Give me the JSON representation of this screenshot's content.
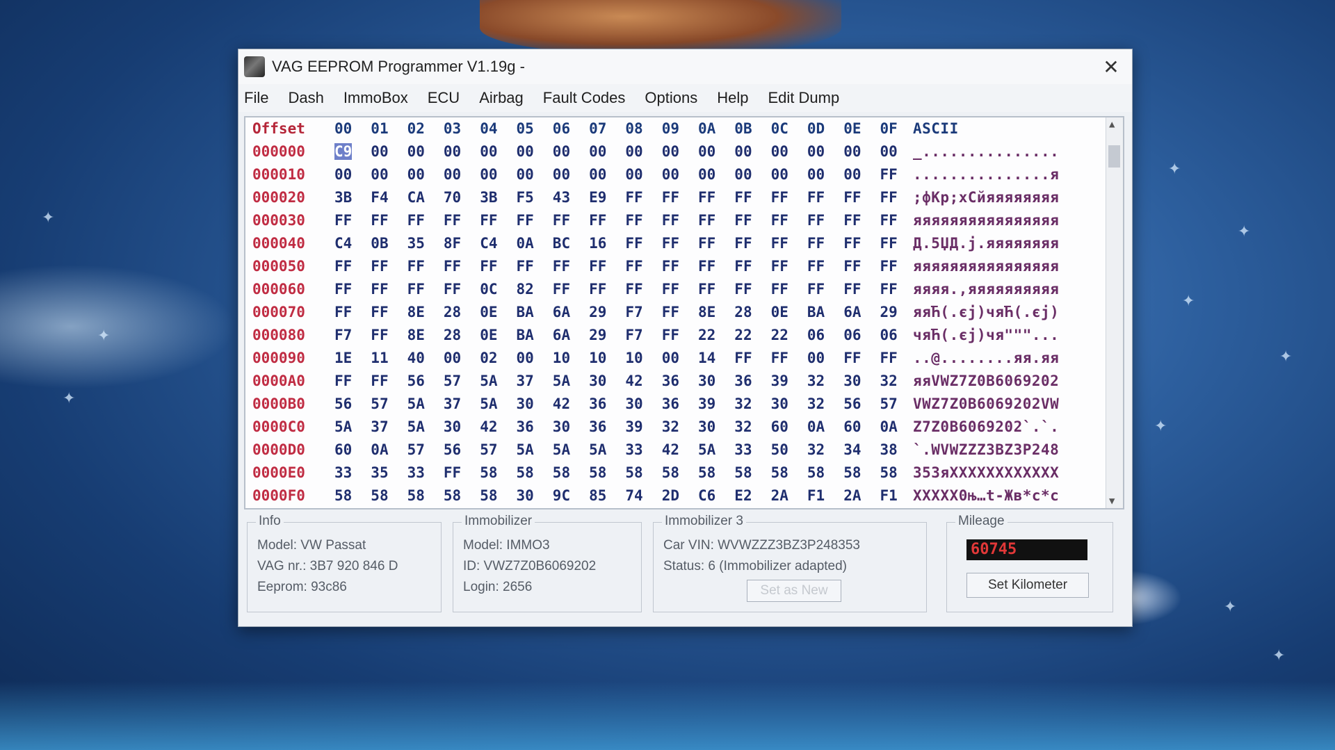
{
  "window": {
    "title": "VAG EEPROM Programmer  V1.19g -"
  },
  "menu": [
    "File",
    "Dash",
    "ImmoBox",
    "ECU",
    "Airbag",
    "Fault Codes",
    "Options",
    "Help",
    "Edit Dump"
  ],
  "hex": {
    "offset_label": "Offset",
    "col_headers": [
      "00",
      "01",
      "02",
      "03",
      "04",
      "05",
      "06",
      "07",
      "08",
      "09",
      "0A",
      "0B",
      "0C",
      "0D",
      "0E",
      "0F"
    ],
    "ascii_label": "ASCII",
    "selected_cell": {
      "row": 0,
      "col": 0
    },
    "rows": [
      {
        "offset": "000000",
        "bytes": [
          "C9",
          "00",
          "00",
          "00",
          "00",
          "00",
          "00",
          "00",
          "00",
          "00",
          "00",
          "00",
          "00",
          "00",
          "00",
          "00"
        ],
        "ascii": "_..............."
      },
      {
        "offset": "000010",
        "bytes": [
          "00",
          "00",
          "00",
          "00",
          "00",
          "00",
          "00",
          "00",
          "00",
          "00",
          "00",
          "00",
          "00",
          "00",
          "00",
          "FF"
        ],
        "ascii": "...............я"
      },
      {
        "offset": "000020",
        "bytes": [
          "3B",
          "F4",
          "CA",
          "70",
          "3B",
          "F5",
          "43",
          "E9",
          "FF",
          "FF",
          "FF",
          "FF",
          "FF",
          "FF",
          "FF",
          "FF"
        ],
        "ascii": ";фКp;хCйяяяяяяяя"
      },
      {
        "offset": "000030",
        "bytes": [
          "FF",
          "FF",
          "FF",
          "FF",
          "FF",
          "FF",
          "FF",
          "FF",
          "FF",
          "FF",
          "FF",
          "FF",
          "FF",
          "FF",
          "FF",
          "FF"
        ],
        "ascii": "яяяяяяяяяяяяяяяя"
      },
      {
        "offset": "000040",
        "bytes": [
          "C4",
          "0B",
          "35",
          "8F",
          "C4",
          "0A",
          "BC",
          "16",
          "FF",
          "FF",
          "FF",
          "FF",
          "FF",
          "FF",
          "FF",
          "FF"
        ],
        "ascii": "Д.5ЏД.j.яяяяяяяя"
      },
      {
        "offset": "000050",
        "bytes": [
          "FF",
          "FF",
          "FF",
          "FF",
          "FF",
          "FF",
          "FF",
          "FF",
          "FF",
          "FF",
          "FF",
          "FF",
          "FF",
          "FF",
          "FF",
          "FF"
        ],
        "ascii": "яяяяяяяяяяяяяяяя"
      },
      {
        "offset": "000060",
        "bytes": [
          "FF",
          "FF",
          "FF",
          "FF",
          "0C",
          "82",
          "FF",
          "FF",
          "FF",
          "FF",
          "FF",
          "FF",
          "FF",
          "FF",
          "FF",
          "FF"
        ],
        "ascii": "яяяя.,яяяяяяяяяя"
      },
      {
        "offset": "000070",
        "bytes": [
          "FF",
          "FF",
          "8E",
          "28",
          "0E",
          "BA",
          "6A",
          "29",
          "F7",
          "FF",
          "8E",
          "28",
          "0E",
          "BA",
          "6A",
          "29"
        ],
        "ascii": "яяЋ(.єj)чяЋ(.єj)"
      },
      {
        "offset": "000080",
        "bytes": [
          "F7",
          "FF",
          "8E",
          "28",
          "0E",
          "BA",
          "6A",
          "29",
          "F7",
          "FF",
          "22",
          "22",
          "22",
          "06",
          "06",
          "06"
        ],
        "ascii": "чяЋ(.єj)чя\"\"\"..."
      },
      {
        "offset": "000090",
        "bytes": [
          "1E",
          "11",
          "40",
          "00",
          "02",
          "00",
          "10",
          "10",
          "10",
          "00",
          "14",
          "FF",
          "FF",
          "00",
          "FF",
          "FF"
        ],
        "ascii": "..@........яя.яя"
      },
      {
        "offset": "0000A0",
        "bytes": [
          "FF",
          "FF",
          "56",
          "57",
          "5A",
          "37",
          "5A",
          "30",
          "42",
          "36",
          "30",
          "36",
          "39",
          "32",
          "30",
          "32"
        ],
        "ascii": "яяVWZ7Z0B6069202"
      },
      {
        "offset": "0000B0",
        "bytes": [
          "56",
          "57",
          "5A",
          "37",
          "5A",
          "30",
          "42",
          "36",
          "30",
          "36",
          "39",
          "32",
          "30",
          "32",
          "56",
          "57"
        ],
        "ascii": "VWZ7Z0B6069202VW"
      },
      {
        "offset": "0000C0",
        "bytes": [
          "5A",
          "37",
          "5A",
          "30",
          "42",
          "36",
          "30",
          "36",
          "39",
          "32",
          "30",
          "32",
          "60",
          "0A",
          "60",
          "0A"
        ],
        "ascii": "Z7Z0B6069202`.`."
      },
      {
        "offset": "0000D0",
        "bytes": [
          "60",
          "0A",
          "57",
          "56",
          "57",
          "5A",
          "5A",
          "5A",
          "33",
          "42",
          "5A",
          "33",
          "50",
          "32",
          "34",
          "38"
        ],
        "ascii": "`.WVWZZZ3BZ3P248"
      },
      {
        "offset": "0000E0",
        "bytes": [
          "33",
          "35",
          "33",
          "FF",
          "58",
          "58",
          "58",
          "58",
          "58",
          "58",
          "58",
          "58",
          "58",
          "58",
          "58",
          "58"
        ],
        "ascii": "353яXXXXXXXXXXXX"
      },
      {
        "offset": "0000F0",
        "bytes": [
          "58",
          "58",
          "58",
          "58",
          "58",
          "30",
          "9C",
          "85",
          "74",
          "2D",
          "C6",
          "E2",
          "2A",
          "F1",
          "2A",
          "F1"
        ],
        "ascii": "XXXXX0њ…t-Жв*с*с"
      }
    ]
  },
  "info": {
    "title": "Info",
    "model": "Model:  VW Passat",
    "vag_nr": "VAG nr.: 3B7 920 846 D",
    "eeprom": "Eeprom: 93c86"
  },
  "immobilizer": {
    "title": "Immobilizer",
    "model": "Model:  IMMO3",
    "id": "ID: VWZ7Z0B6069202",
    "login": "Login: 2656"
  },
  "immobilizer3": {
    "title": "Immobilizer 3",
    "vin": "Car VIN: WVWZZZ3BZ3P248353",
    "status": "Status: 6 (Immobilizer adapted)",
    "set_as_new": "Set as New"
  },
  "mileage": {
    "title": "Mileage",
    "value": "60745",
    "set_button": "Set Kilometer"
  }
}
